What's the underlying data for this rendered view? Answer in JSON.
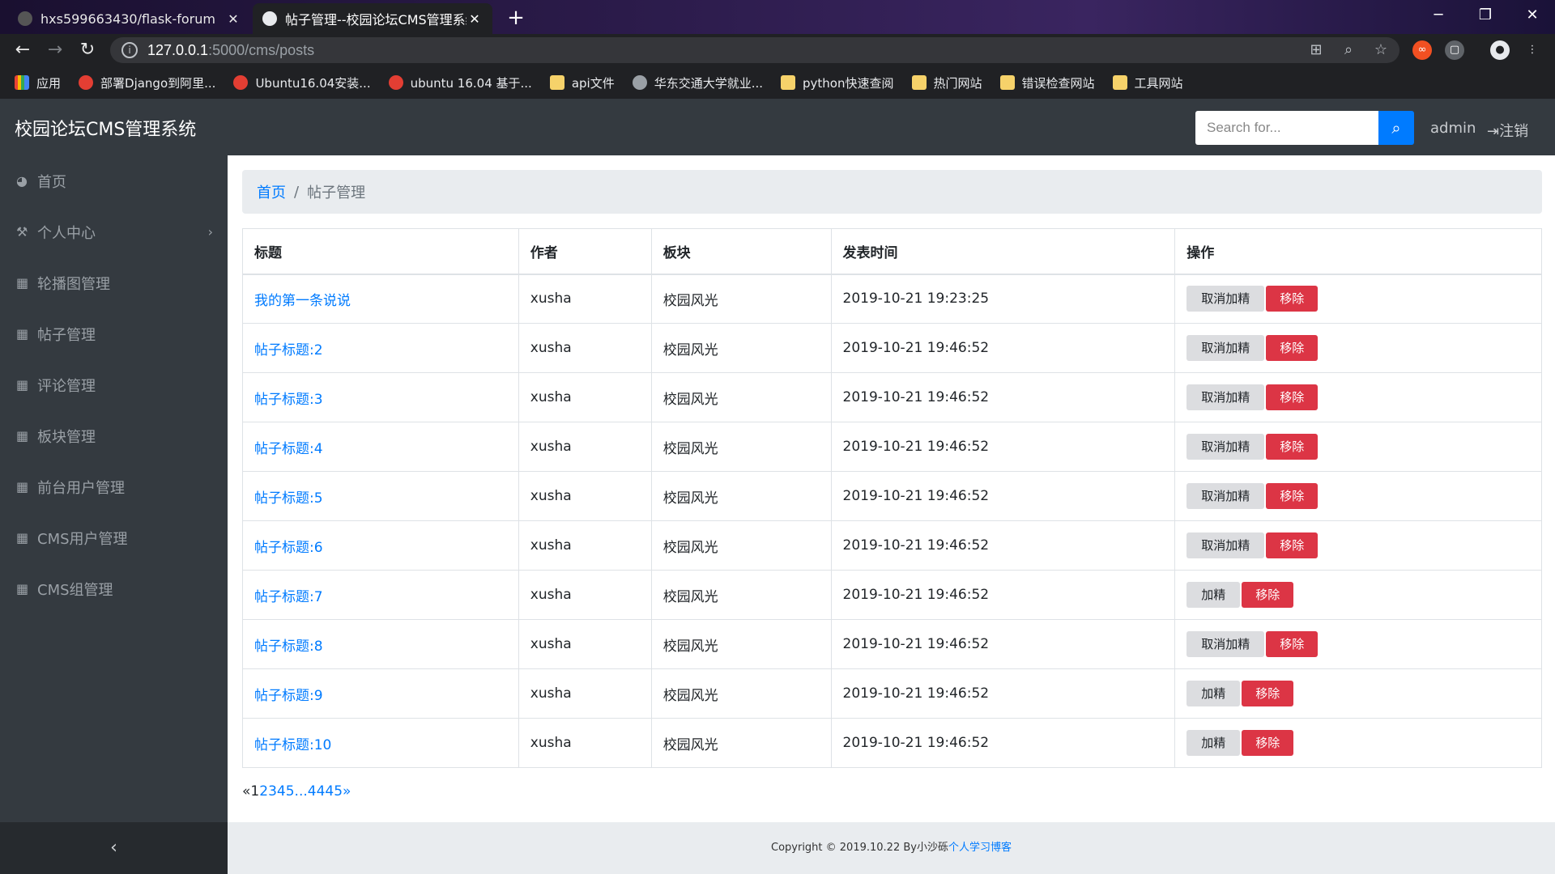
{
  "browser": {
    "tabs": [
      {
        "title": "hxs599663430/flask-forum",
        "active": false
      },
      {
        "title": "帖子管理--校园论坛CMS管理系统",
        "active": true
      }
    ],
    "url_host": "127.0.0.1",
    "url_path": ":5000/cms/posts",
    "bookmarks": [
      {
        "label": "应用",
        "icon": "apps-grid-icon"
      },
      {
        "label": "部署Django到阿里...",
        "icon": "csdn-icon"
      },
      {
        "label": "Ubuntu16.04安装...",
        "icon": "csdn-icon"
      },
      {
        "label": "ubuntu 16.04 基于...",
        "icon": "csdn-icon"
      },
      {
        "label": "api文件",
        "icon": "folder-icon"
      },
      {
        "label": "华东交通大学就业...",
        "icon": "globe-icon"
      },
      {
        "label": "python快速查阅",
        "icon": "folder-icon"
      },
      {
        "label": "热门网站",
        "icon": "folder-icon"
      },
      {
        "label": "错误检查网站",
        "icon": "folder-icon"
      },
      {
        "label": "工具网站",
        "icon": "folder-icon"
      }
    ]
  },
  "header": {
    "brand": "校园论坛CMS管理系统",
    "search_placeholder": "Search for...",
    "user": "admin",
    "logout": "注销"
  },
  "sidebar": {
    "items": [
      {
        "label": "首页",
        "icon": "dashboard-icon"
      },
      {
        "label": "个人中心",
        "icon": "wrench-icon",
        "has_submenu": true
      },
      {
        "label": "轮播图管理",
        "icon": "table-icon"
      },
      {
        "label": "帖子管理",
        "icon": "table-icon"
      },
      {
        "label": "评论管理",
        "icon": "table-icon"
      },
      {
        "label": "板块管理",
        "icon": "table-icon"
      },
      {
        "label": "前台用户管理",
        "icon": "table-icon"
      },
      {
        "label": "CMS用户管理",
        "icon": "table-icon"
      },
      {
        "label": "CMS组管理",
        "icon": "table-icon"
      }
    ],
    "toggle": "‹"
  },
  "breadcrumb": {
    "home": "首页",
    "current": "帖子管理"
  },
  "table": {
    "headers": [
      "标题",
      "作者",
      "板块",
      "发表时间",
      "操作"
    ],
    "rows": [
      {
        "title": "我的第一条说说",
        "author": "xusha",
        "board": "校园风光",
        "time": "2019-10-21 19:23:25",
        "highlight_label": "取消加精",
        "remove_label": "移除"
      },
      {
        "title": "帖子标题:2",
        "author": "xusha",
        "board": "校园风光",
        "time": "2019-10-21 19:46:52",
        "highlight_label": "取消加精",
        "remove_label": "移除"
      },
      {
        "title": "帖子标题:3",
        "author": "xusha",
        "board": "校园风光",
        "time": "2019-10-21 19:46:52",
        "highlight_label": "取消加精",
        "remove_label": "移除"
      },
      {
        "title": "帖子标题:4",
        "author": "xusha",
        "board": "校园风光",
        "time": "2019-10-21 19:46:52",
        "highlight_label": "取消加精",
        "remove_label": "移除"
      },
      {
        "title": "帖子标题:5",
        "author": "xusha",
        "board": "校园风光",
        "time": "2019-10-21 19:46:52",
        "highlight_label": "取消加精",
        "remove_label": "移除"
      },
      {
        "title": "帖子标题:6",
        "author": "xusha",
        "board": "校园风光",
        "time": "2019-10-21 19:46:52",
        "highlight_label": "取消加精",
        "remove_label": "移除"
      },
      {
        "title": "帖子标题:7",
        "author": "xusha",
        "board": "校园风光",
        "time": "2019-10-21 19:46:52",
        "highlight_label": "加精",
        "remove_label": "移除"
      },
      {
        "title": "帖子标题:8",
        "author": "xusha",
        "board": "校园风光",
        "time": "2019-10-21 19:46:52",
        "highlight_label": "取消加精",
        "remove_label": "移除"
      },
      {
        "title": "帖子标题:9",
        "author": "xusha",
        "board": "校园风光",
        "time": "2019-10-21 19:46:52",
        "highlight_label": "加精",
        "remove_label": "移除"
      },
      {
        "title": "帖子标题:10",
        "author": "xusha",
        "board": "校园风光",
        "time": "2019-10-21 19:46:52",
        "highlight_label": "加精",
        "remove_label": "移除"
      }
    ]
  },
  "pagination": {
    "prev": "«",
    "current": "1",
    "pages": [
      "2",
      "3",
      "4",
      "5"
    ],
    "ellipsis": "...",
    "tail": [
      "4445"
    ],
    "next": "»"
  },
  "footer": {
    "text": "Copyright © 2019.10.22 By小沙砾",
    "link": "个人学习博客"
  },
  "colors": {
    "primary": "#007bff",
    "danger": "#dc3545",
    "dark": "#343a40"
  }
}
